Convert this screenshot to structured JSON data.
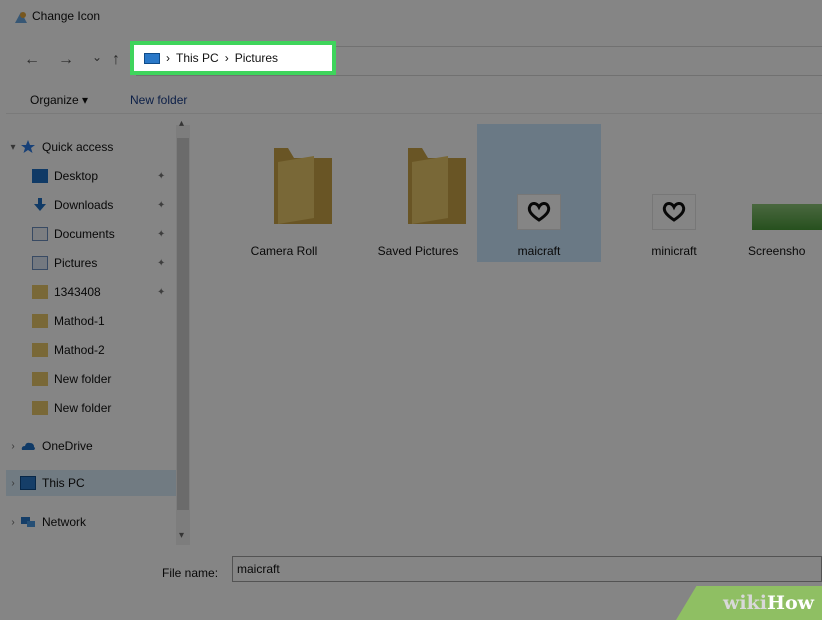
{
  "window": {
    "title": "Change Icon"
  },
  "nav": {
    "back": "←",
    "forward": "→",
    "recent": "⌄",
    "up": "↑"
  },
  "breadcrumb": {
    "sep1": "›",
    "item1": "This PC",
    "sep2": "›",
    "item2": "Pictures"
  },
  "toolbar": {
    "organize": "Organize ▾",
    "new_folder": "New folder"
  },
  "sidebar": {
    "quick_access": "Quick access",
    "items": [
      "Desktop",
      "Downloads",
      "Documents",
      "Pictures",
      "1343408",
      "Mathod-1",
      "Mathod-2",
      "New folder",
      "New folder"
    ],
    "onedrive": "OneDrive",
    "this_pc": "This PC",
    "network": "Network"
  },
  "files": [
    "Camera Roll",
    "Saved Pictures",
    "maicraft",
    "minicraft",
    "Screensho"
  ],
  "file_name": {
    "label": "File name:",
    "value": "maicraft"
  },
  "watermark": {
    "wiki": "wiki",
    "how": "How"
  },
  "colors": {
    "highlight": "#3fd45c",
    "selection": "#cce8ff",
    "folder": "#e8c86a",
    "overlay": "rgba(0,0,0,0.48)"
  },
  "icons": [
    "change-icon-app-icon",
    "back-arrow-icon",
    "forward-arrow-icon",
    "recent-chevron-icon",
    "up-arrow-icon",
    "this-pc-icon",
    "star-icon",
    "desktop-icon",
    "downloads-icon",
    "documents-icon",
    "pictures-icon",
    "folder-icon",
    "pin-icon",
    "onedrive-icon",
    "this-pc-icon",
    "network-icon",
    "heart-icon"
  ]
}
